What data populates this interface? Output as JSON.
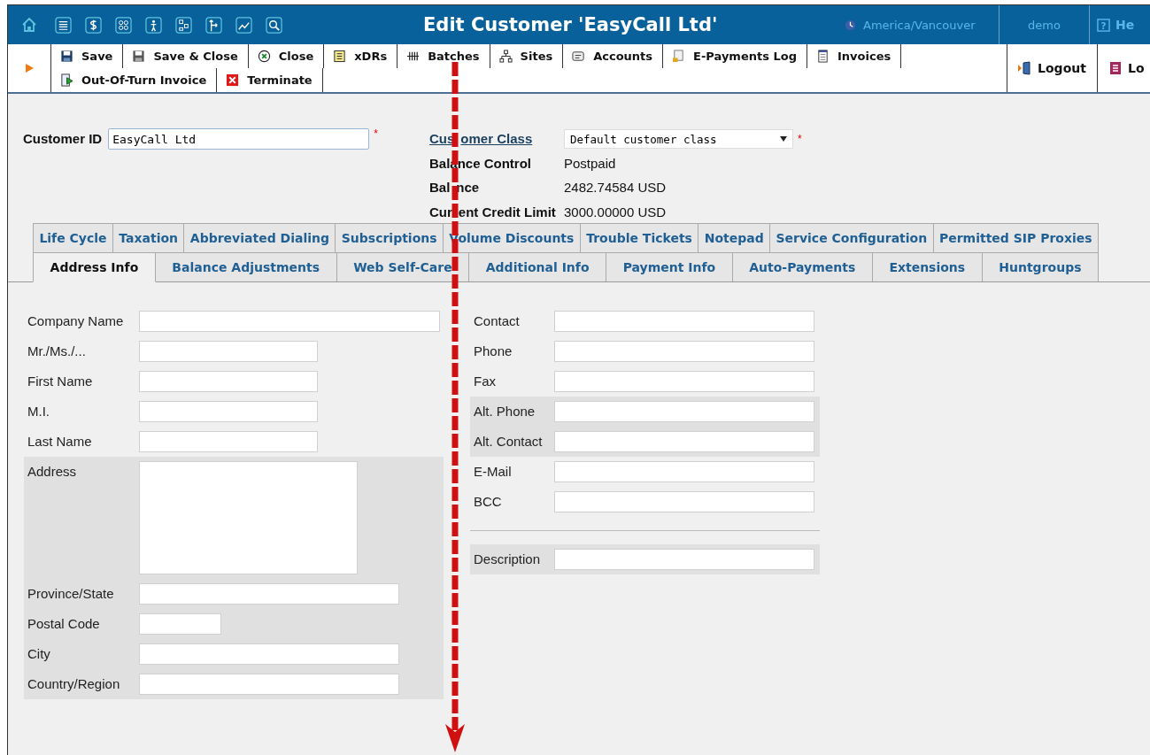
{
  "header": {
    "title": "Edit Customer 'EasyCall Ltd'",
    "timezone": "America/Vancouver",
    "user": "demo",
    "help_icon": "?",
    "help": "He"
  },
  "toolbar": {
    "button_rows": [
      {
        "buttons": [
          "Save",
          "Save & Close",
          "Close",
          "xDRs",
          "Batches",
          "Sites",
          "Accounts",
          "E-Payments Log",
          "Invoices"
        ]
      },
      {
        "buttons": [
          "Out-Of-Turn Invoice",
          "Terminate"
        ]
      }
    ],
    "logout": "Logout",
    "log": "Lo"
  },
  "customer": {
    "required_mark": "*",
    "id_label": "Customer ID",
    "id_value": "EasyCall Ltd",
    "id_required": true,
    "class_label": [
      "Cus",
      "omer Class"
    ],
    "class_value": "Default customer class",
    "class_required": true,
    "info": [
      {
        "label": [
          "Balance Control"
        ],
        "value": "Postpaid"
      },
      {
        "label": [
          "Bal",
          "nce"
        ],
        "value": "2482.74584 USD"
      },
      {
        "label": [
          "Cur",
          "ent Credit Limit"
        ],
        "value": "3000.00000 USD"
      }
    ]
  },
  "tab_rows": [
    {
      "tabs": [
        {
          "label": "Life Cycle",
          "selected": false
        },
        {
          "label": "Taxation",
          "selected": false
        },
        {
          "label": "Abbreviated Dialing",
          "selected": false
        },
        {
          "label": "Subscriptions",
          "selected": false
        },
        {
          "label": "Volume Discounts",
          "selected": false
        },
        {
          "label": "Trouble Tickets",
          "selected": false
        },
        {
          "label": "Notepad",
          "selected": false
        },
        {
          "label": "Service Configuration",
          "selected": false
        },
        {
          "label": "Permitted SIP Proxies",
          "selected": false
        }
      ]
    },
    {
      "tabs": [
        {
          "label": "Address Info",
          "selected": true
        },
        {
          "label": "Balance Adjustments",
          "selected": false
        },
        {
          "label": "Web Self-Care",
          "selected": false
        },
        {
          "label": "Additional Info",
          "selected": false
        },
        {
          "label": "Payment Info",
          "selected": false
        },
        {
          "label": "Auto-Payments",
          "selected": false
        },
        {
          "label": "Extensions",
          "selected": false
        },
        {
          "label": "Huntgroups",
          "selected": false
        }
      ]
    }
  ],
  "form": {
    "left": [
      {
        "fields": [
          {
            "label": "Company Name",
            "kind": "wide",
            "highlighted": false
          },
          {
            "label": "Mr./Ms./...",
            "kind": "normal",
            "highlighted": false
          },
          {
            "label": "First Name",
            "kind": "normal",
            "highlighted": false
          },
          {
            "label": "M.I.",
            "kind": "normal",
            "highlighted": false
          },
          {
            "label": "Last Name",
            "kind": "normal",
            "highlighted": false
          },
          {
            "label": "Address",
            "kind": "textarea",
            "highlighted": true
          },
          {
            "label": "Province/State",
            "kind": "medium",
            "highlighted": true
          },
          {
            "label": "Postal Code",
            "kind": "small",
            "highlighted": true
          },
          {
            "label": "City",
            "kind": "medium",
            "highlighted": true
          },
          {
            "label": "Country/Region",
            "kind": "medium",
            "highlighted": true
          }
        ]
      }
    ],
    "right": [
      {
        "fields": [
          {
            "label": "Contact",
            "kind": "medium",
            "highlighted": false
          },
          {
            "label": "Phone",
            "kind": "medium",
            "highlighted": false
          },
          {
            "label": "Fax",
            "kind": "medium",
            "highlighted": false
          },
          {
            "label": "Alt. Phone",
            "kind": "medium",
            "highlighted": true
          },
          {
            "label": "Alt. Contact",
            "kind": "medium",
            "highlighted": true
          },
          {
            "label": "E-Mail",
            "kind": "medium",
            "highlighted": false
          },
          {
            "label": "BCC",
            "kind": "medium",
            "highlighted": false
          }
        ]
      },
      {
        "fields": [
          {
            "label": "Description",
            "kind": "medium",
            "highlighted": true
          }
        ]
      }
    ]
  }
}
